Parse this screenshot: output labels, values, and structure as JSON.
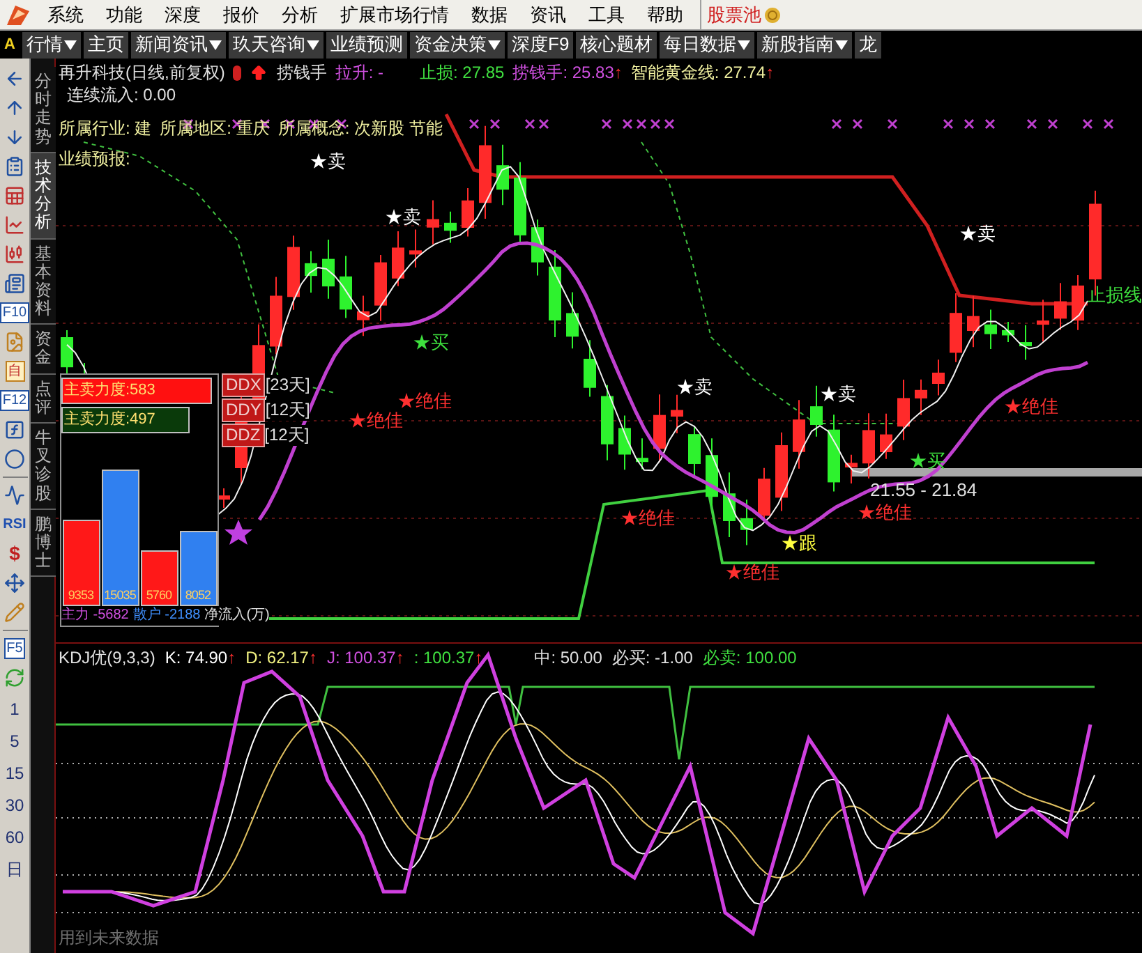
{
  "menu": {
    "items": [
      "系统",
      "功能",
      "深度",
      "报价",
      "分析",
      "扩展市场行情",
      "数据",
      "资讯",
      "工具",
      "帮助"
    ],
    "highlight": "股票池"
  },
  "toolbar": {
    "tag": "A",
    "tabs": [
      {
        "label": "行情",
        "dropdown": true
      },
      {
        "label": "主页",
        "dropdown": false
      },
      {
        "label": "新闻资讯",
        "dropdown": true
      },
      {
        "label": "玖天咨询",
        "dropdown": true
      },
      {
        "label": "业绩预测",
        "dropdown": false
      },
      {
        "label": "资金决策",
        "dropdown": true
      },
      {
        "label": "深度F9",
        "dropdown": false
      },
      {
        "label": "核心题材",
        "dropdown": false
      },
      {
        "label": "每日数据",
        "dropdown": true
      },
      {
        "label": "新股指南",
        "dropdown": true
      },
      {
        "label": "龙",
        "dropdown": false
      }
    ]
  },
  "left_toolbar": {
    "labels": [
      "F10",
      "自",
      "F12",
      "RSI",
      "$",
      "F5"
    ],
    "periods": [
      "1",
      "5",
      "15",
      "30",
      "60",
      "日"
    ]
  },
  "vertical_tabs": [
    {
      "label": "分时走势",
      "selected": false
    },
    {
      "label": "技术分析",
      "selected": true
    },
    {
      "label": "基本资料",
      "selected": false
    },
    {
      "label": "资金",
      "selected": false
    },
    {
      "label": "点评",
      "selected": false
    },
    {
      "label": "牛叉诊股",
      "selected": false
    },
    {
      "label": "鹏博士",
      "selected": false
    }
  ],
  "info": {
    "items": [
      {
        "kind": "name",
        "text": "再升科技(日线,前复权)"
      },
      {
        "kind": "label",
        "text": "捞钱手"
      },
      {
        "kind": "purple",
        "text": "拉升: -"
      },
      {
        "kind": "green",
        "text": "止损: 27.85"
      },
      {
        "kind": "purple",
        "text": "捞钱手: 25.83",
        "arrow": "↑"
      },
      {
        "kind": "gold",
        "text": "智能黄金线: 27.74",
        "arrow": "↑"
      }
    ],
    "inflow": "连续流入: 0.00",
    "concepts": [
      "所属行业: 建",
      "所属地区: 重庆",
      "所属概念: 次新股 节能"
    ],
    "forecast": "业绩预报:"
  },
  "markers": [
    {
      "kind": "sell",
      "text": "★卖"
    },
    {
      "kind": "sell",
      "text": "★卖"
    },
    {
      "kind": "buy",
      "text": "★买"
    },
    {
      "kind": "best",
      "text": "★绝佳"
    },
    {
      "kind": "best",
      "text": "★绝佳"
    },
    {
      "kind": "sell",
      "text": "★卖"
    },
    {
      "kind": "sell",
      "text": "★卖"
    },
    {
      "kind": "sell",
      "text": "★卖"
    },
    {
      "kind": "best",
      "text": "★绝佳"
    },
    {
      "kind": "best",
      "text": "★绝佳"
    },
    {
      "kind": "follow",
      "text": "★跟"
    },
    {
      "kind": "best",
      "text": "★绝佳"
    },
    {
      "kind": "best",
      "text": "★绝佳"
    },
    {
      "kind": "buy",
      "text": "★买"
    },
    {
      "kind": "range",
      "text": "21.55 - 21.84"
    },
    {
      "kind": "stop",
      "text": "止损线"
    }
  ],
  "ddx": [
    {
      "label": "DDX",
      "days": "[23天]"
    },
    {
      "label": "DDY",
      "days": "[12天]"
    },
    {
      "label": "DDZ",
      "days": "[12天]"
    }
  ],
  "flow_panel": {
    "strength": [
      {
        "kind": "red",
        "text": "主卖力度:583"
      },
      {
        "kind": "green",
        "text": "主卖力度:497"
      }
    ],
    "bar_values": [
      "9353",
      "15035",
      "5760",
      "8052"
    ],
    "summary": [
      {
        "kind": "main",
        "text": "主力 -5682"
      },
      {
        "kind": "retail",
        "text": "散户 -2188"
      },
      {
        "kind": "net",
        "text": "净流入(万)"
      }
    ]
  },
  "kdj": {
    "items": [
      {
        "kind": "title",
        "text": "KDJ优(9,3,3)"
      },
      {
        "kind": "k",
        "text": "K: 74.90",
        "arrow": "↑"
      },
      {
        "kind": "d",
        "text": "D: 62.17",
        "arrow": "↑"
      },
      {
        "kind": "j",
        "text": "J: 100.37",
        "arrow": "↑"
      },
      {
        "kind": "green",
        "text": ": 100.37",
        "arrow": "↑"
      },
      {
        "kind": "plain",
        "text": "中: 50.00"
      },
      {
        "kind": "plain",
        "text": "必买: -1.00"
      },
      {
        "kind": "green",
        "text": "必卖: 100.00"
      }
    ],
    "footer": "用到未来数据"
  }
}
